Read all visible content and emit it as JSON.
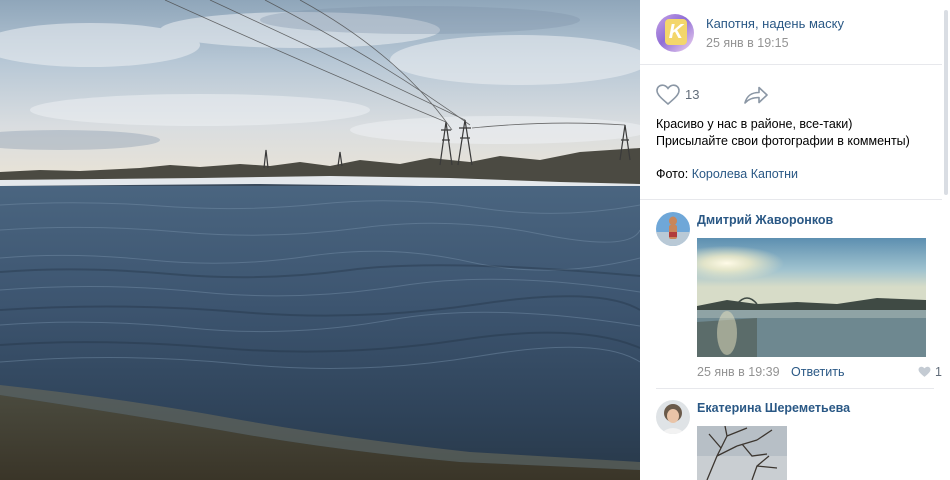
{
  "post": {
    "group_name": "Капотня, надень маску",
    "avatar_letter": "K",
    "date": "25 янв в 19:15",
    "likes": "13",
    "text_lines": [
      "Красиво у нас в районе, все-таки)",
      "Присылайте свои фотографии в комменты)"
    ],
    "photo_label": "Фото:",
    "photo_author": "Королева Капотни"
  },
  "comments": [
    {
      "author": "Дмитрий Жаворонков",
      "date": "25 янв в 19:39",
      "reply_label": "Ответить",
      "likes": "1"
    },
    {
      "author": "Екатерина Шереметьева"
    }
  ],
  "colors": {
    "link": "#2a5885",
    "meta": "#939393",
    "divider": "#e7e8ec"
  },
  "icons": [
    "heart-icon",
    "share-arrow-icon",
    "small-heart-icon"
  ]
}
